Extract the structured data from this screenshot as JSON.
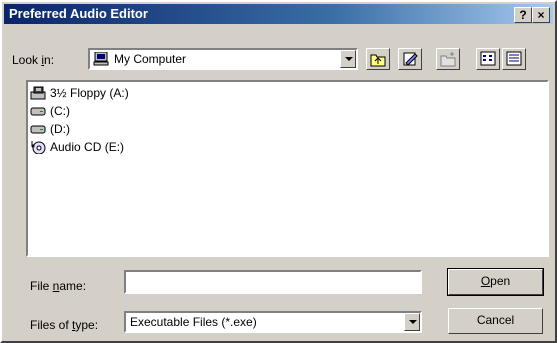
{
  "window": {
    "title": "Preferred Audio Editor",
    "help_label": "?",
    "close_label": "×"
  },
  "look_in": {
    "prefix": "Look ",
    "hotkey": "i",
    "suffix": "n:",
    "value": "My Computer"
  },
  "toolbar": {
    "up_icon": "up-one-level-icon",
    "favorite_icon": "edit-icon",
    "new_folder_icon": "new-folder-icon",
    "list_view_icon": "list-view-icon",
    "details_view_icon": "details-view-icon"
  },
  "file_list": {
    "items": [
      {
        "label": "3½ Floppy (A:)",
        "icon": "floppy-drive-icon"
      },
      {
        "label": "(C:)",
        "icon": "hard-drive-icon"
      },
      {
        "label": "(D:)",
        "icon": "hard-drive-icon"
      },
      {
        "label": "Audio CD (E:)",
        "icon": "audio-cd-icon"
      }
    ]
  },
  "file_name": {
    "prefix": "File ",
    "hotkey": "n",
    "suffix": "ame:",
    "value": "",
    "placeholder": ""
  },
  "file_type": {
    "prefix": "Files of ",
    "hotkey": "t",
    "suffix": "ype:",
    "value": "Executable Files (*.exe)"
  },
  "buttons": {
    "open_hotkey": "O",
    "open_rest": "pen",
    "cancel": "Cancel"
  }
}
